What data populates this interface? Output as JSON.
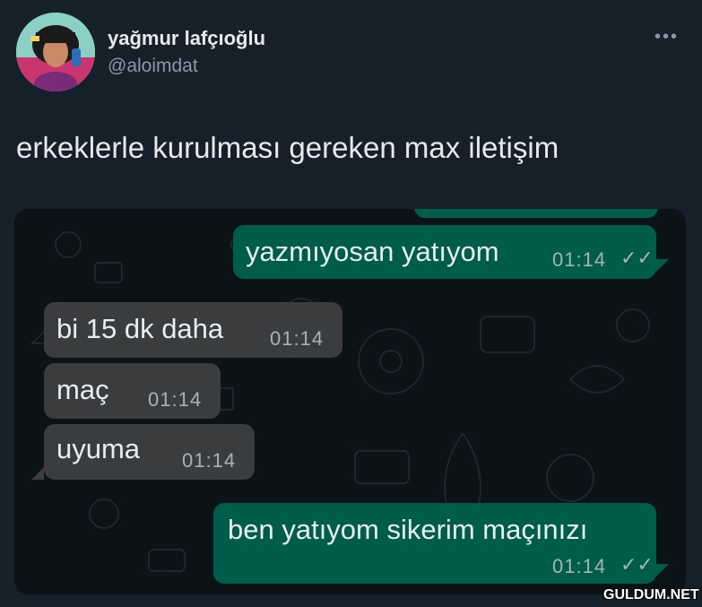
{
  "tweet": {
    "display_name": "yağmur lafçıoğlu",
    "handle": "@aloimdat",
    "text": "erkeklerle kurulması gereken max iletişim",
    "more_icon": "more-horizontal-icon"
  },
  "chat": {
    "messages": [
      {
        "direction": "out",
        "text": "yazmıyosan yatıyom",
        "time": "01:14",
        "status": "read"
      },
      {
        "direction": "in",
        "text": "bi 15 dk daha",
        "time": "01:14"
      },
      {
        "direction": "in",
        "text": "maç",
        "time": "01:14"
      },
      {
        "direction": "in",
        "text": "uyuma",
        "time": "01:14"
      },
      {
        "direction": "out",
        "text": "ben yatıyom sikerim maçınızı",
        "time": "01:14",
        "status": "read"
      }
    ],
    "colors": {
      "outgoing": "#005c4b",
      "incoming": "#3a3c3e",
      "background": "#0c1317"
    }
  },
  "watermark": "GULDUM.NET",
  "colors": {
    "page_background": "#15202b",
    "text_primary": "#e7e9ea",
    "text_secondary": "#8b98a5"
  }
}
